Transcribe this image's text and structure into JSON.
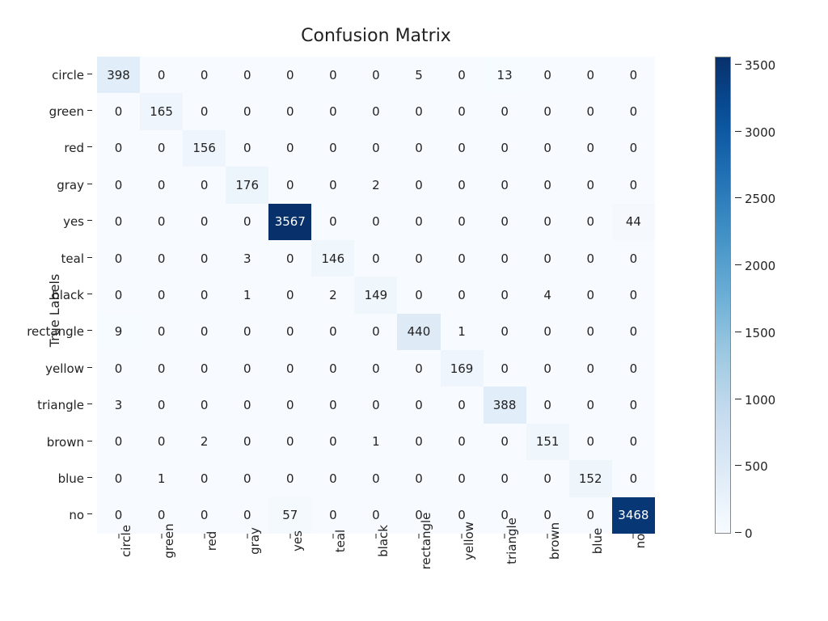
{
  "chart_data": {
    "type": "heatmap",
    "title": "Confusion Matrix",
    "xlabel": "",
    "ylabel": "True Labels",
    "categories_y": [
      "circle",
      "green",
      "red",
      "gray",
      "yes",
      "teal",
      "black",
      "rectangle",
      "yellow",
      "triangle",
      "brown",
      "blue",
      "no"
    ],
    "categories_x": [
      "circle",
      "green",
      "red",
      "gray",
      "yes",
      "teal",
      "black",
      "rectangle",
      "yellow",
      "triangle",
      "brown",
      "blue",
      "no"
    ],
    "matrix": [
      [
        398,
        0,
        0,
        0,
        0,
        0,
        0,
        5,
        0,
        13,
        0,
        0,
        0
      ],
      [
        0,
        165,
        0,
        0,
        0,
        0,
        0,
        0,
        0,
        0,
        0,
        0,
        0
      ],
      [
        0,
        0,
        156,
        0,
        0,
        0,
        0,
        0,
        0,
        0,
        0,
        0,
        0
      ],
      [
        0,
        0,
        0,
        176,
        0,
        0,
        2,
        0,
        0,
        0,
        0,
        0,
        0
      ],
      [
        0,
        0,
        0,
        0,
        3567,
        0,
        0,
        0,
        0,
        0,
        0,
        0,
        44
      ],
      [
        0,
        0,
        0,
        3,
        0,
        146,
        0,
        0,
        0,
        0,
        0,
        0,
        0
      ],
      [
        0,
        0,
        0,
        1,
        0,
        2,
        149,
        0,
        0,
        0,
        4,
        0,
        0
      ],
      [
        9,
        0,
        0,
        0,
        0,
        0,
        0,
        440,
        1,
        0,
        0,
        0,
        0
      ],
      [
        0,
        0,
        0,
        0,
        0,
        0,
        0,
        0,
        169,
        0,
        0,
        0,
        0
      ],
      [
        3,
        0,
        0,
        0,
        0,
        0,
        0,
        0,
        0,
        388,
        0,
        0,
        0
      ],
      [
        0,
        0,
        2,
        0,
        0,
        0,
        1,
        0,
        0,
        0,
        151,
        0,
        0
      ],
      [
        0,
        1,
        0,
        0,
        0,
        0,
        0,
        0,
        0,
        0,
        0,
        152,
        0
      ],
      [
        0,
        0,
        0,
        0,
        57,
        0,
        0,
        0,
        0,
        0,
        0,
        0,
        3468
      ]
    ],
    "value_range": [
      0,
      3567
    ],
    "colorbar_ticks": [
      0,
      500,
      1000,
      1500,
      2000,
      2500,
      3000,
      3500
    ],
    "cmap": "Blues"
  }
}
